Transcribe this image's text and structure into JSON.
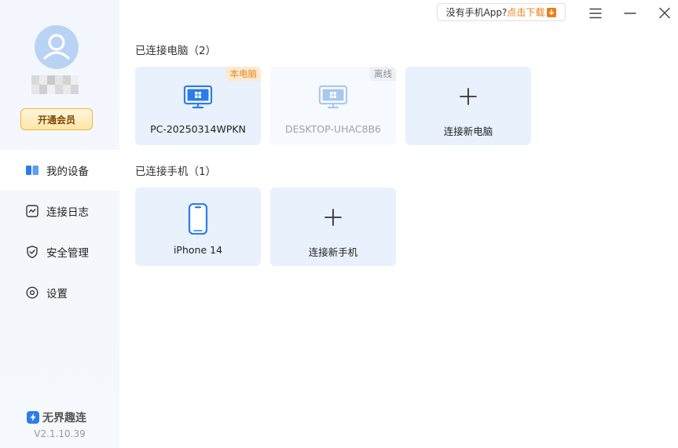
{
  "header": {
    "download_prefix": "没有手机App?",
    "download_link": "点击下载"
  },
  "sidebar": {
    "vip_label": "开通会员",
    "nav": [
      {
        "label": "我的设备",
        "icon": "devices-icon",
        "active": true
      },
      {
        "label": "连接日志",
        "icon": "log-icon",
        "active": false
      },
      {
        "label": "安全管理",
        "icon": "shield-icon",
        "active": false
      },
      {
        "label": "设置",
        "icon": "settings-icon",
        "active": false
      }
    ],
    "brand": "无界趣连",
    "version": "V2.1.10.39"
  },
  "computers": {
    "title": "已连接电脑（2）",
    "items": [
      {
        "name": "PC-20250314WPKN",
        "tag": "本电脑",
        "status": "local"
      },
      {
        "name": "DESKTOP-UHAC8B6",
        "tag": "离线",
        "status": "offline"
      }
    ],
    "add_label": "连接新电脑"
  },
  "phones": {
    "title": "已连接手机（1）",
    "items": [
      {
        "name": "iPhone 14"
      }
    ],
    "add_label": "连接新手机"
  },
  "colors": {
    "accent_blue": "#2b7de9",
    "card_bg": "#e8f1fc",
    "vip_border": "#f2b63d",
    "download_accent": "#f07a14"
  }
}
